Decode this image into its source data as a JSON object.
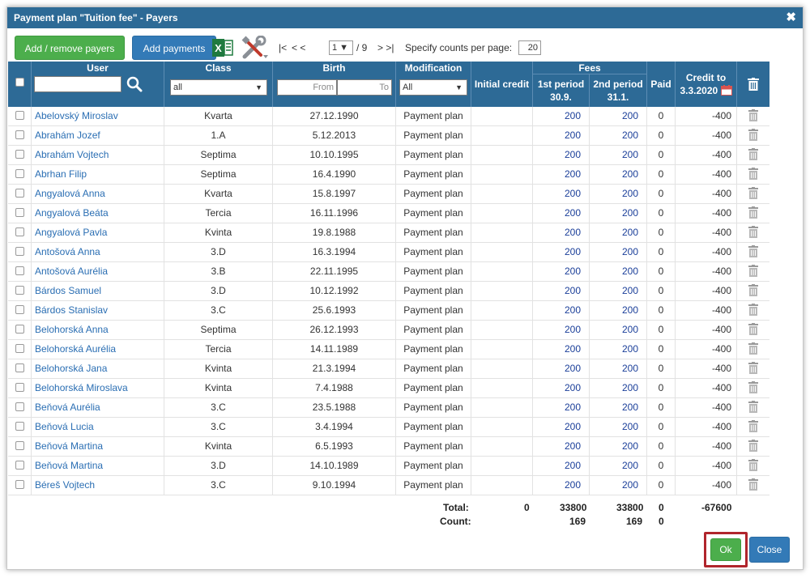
{
  "dialog": {
    "title": "Payment plan \"Tuition fee\" - Payers",
    "close_glyph": "✖"
  },
  "toolbar": {
    "add_remove_label": "Add / remove payers",
    "add_payments_label": "Add payments",
    "excel_icon": "excel-export-icon",
    "tools_icon": "tools-icon",
    "pager_first": "|<",
    "pager_prev": "< <",
    "page_value": "1 ▼",
    "page_total": "/ 9",
    "pager_next": "> >|",
    "counts_label": "Specify counts per page:",
    "counts_value": "20"
  },
  "columns": {
    "user": "User",
    "class": "Class",
    "birth": "Birth",
    "modification": "Modification",
    "initial_credit": "Initial credit",
    "fees": "Fees",
    "period1": "1st period",
    "period1_date": "30.9.",
    "period2": "2nd period",
    "period2_date": "31.1.",
    "paid": "Paid",
    "credit_to": "Credit to",
    "credit_date": "3.3.2020"
  },
  "filters": {
    "user_value": "",
    "class_value": "all",
    "birth_from_placeholder": "From",
    "birth_to_placeholder": "To",
    "modification_value": "All"
  },
  "rows": [
    {
      "user": "Abelovský Miroslav",
      "class": "Kvarta",
      "birth": "27.12.1990",
      "mod": "Payment plan",
      "init": "",
      "p1": "200",
      "p2": "200",
      "paid": "0",
      "credit": "-400"
    },
    {
      "user": "Abrahám Jozef",
      "class": "1.A",
      "birth": "5.12.2013",
      "mod": "Payment plan",
      "init": "",
      "p1": "200",
      "p2": "200",
      "paid": "0",
      "credit": "-400"
    },
    {
      "user": "Abrahám Vojtech",
      "class": "Septima",
      "birth": "10.10.1995",
      "mod": "Payment plan",
      "init": "",
      "p1": "200",
      "p2": "200",
      "paid": "0",
      "credit": "-400"
    },
    {
      "user": "Abrhan Filip",
      "class": "Septima",
      "birth": "16.4.1990",
      "mod": "Payment plan",
      "init": "",
      "p1": "200",
      "p2": "200",
      "paid": "0",
      "credit": "-400"
    },
    {
      "user": "Angyalová Anna",
      "class": "Kvarta",
      "birth": "15.8.1997",
      "mod": "Payment plan",
      "init": "",
      "p1": "200",
      "p2": "200",
      "paid": "0",
      "credit": "-400"
    },
    {
      "user": "Angyalová Beáta",
      "class": "Tercia",
      "birth": "16.11.1996",
      "mod": "Payment plan",
      "init": "",
      "p1": "200",
      "p2": "200",
      "paid": "0",
      "credit": "-400"
    },
    {
      "user": "Angyalová Pavla",
      "class": "Kvinta",
      "birth": "19.8.1988",
      "mod": "Payment plan",
      "init": "",
      "p1": "200",
      "p2": "200",
      "paid": "0",
      "credit": "-400"
    },
    {
      "user": "Antošová Anna",
      "class": "3.D",
      "birth": "16.3.1994",
      "mod": "Payment plan",
      "init": "",
      "p1": "200",
      "p2": "200",
      "paid": "0",
      "credit": "-400"
    },
    {
      "user": "Antošová Aurélia",
      "class": "3.B",
      "birth": "22.11.1995",
      "mod": "Payment plan",
      "init": "",
      "p1": "200",
      "p2": "200",
      "paid": "0",
      "credit": "-400"
    },
    {
      "user": "Bárdos Samuel",
      "class": "3.D",
      "birth": "10.12.1992",
      "mod": "Payment plan",
      "init": "",
      "p1": "200",
      "p2": "200",
      "paid": "0",
      "credit": "-400"
    },
    {
      "user": "Bárdos Stanislav",
      "class": "3.C",
      "birth": "25.6.1993",
      "mod": "Payment plan",
      "init": "",
      "p1": "200",
      "p2": "200",
      "paid": "0",
      "credit": "-400"
    },
    {
      "user": "Belohorská Anna",
      "class": "Septima",
      "birth": "26.12.1993",
      "mod": "Payment plan",
      "init": "",
      "p1": "200",
      "p2": "200",
      "paid": "0",
      "credit": "-400"
    },
    {
      "user": "Belohorská Aurélia",
      "class": "Tercia",
      "birth": "14.11.1989",
      "mod": "Payment plan",
      "init": "",
      "p1": "200",
      "p2": "200",
      "paid": "0",
      "credit": "-400"
    },
    {
      "user": "Belohorská Jana",
      "class": "Kvinta",
      "birth": "21.3.1994",
      "mod": "Payment plan",
      "init": "",
      "p1": "200",
      "p2": "200",
      "paid": "0",
      "credit": "-400"
    },
    {
      "user": "Belohorská Miroslava",
      "class": "Kvinta",
      "birth": "7.4.1988",
      "mod": "Payment plan",
      "init": "",
      "p1": "200",
      "p2": "200",
      "paid": "0",
      "credit": "-400"
    },
    {
      "user": "Beňová Aurélia",
      "class": "3.C",
      "birth": "23.5.1988",
      "mod": "Payment plan",
      "init": "",
      "p1": "200",
      "p2": "200",
      "paid": "0",
      "credit": "-400"
    },
    {
      "user": "Beňová Lucia",
      "class": "3.C",
      "birth": "3.4.1994",
      "mod": "Payment plan",
      "init": "",
      "p1": "200",
      "p2": "200",
      "paid": "0",
      "credit": "-400"
    },
    {
      "user": "Beňová Martina",
      "class": "Kvinta",
      "birth": "6.5.1993",
      "mod": "Payment plan",
      "init": "",
      "p1": "200",
      "p2": "200",
      "paid": "0",
      "credit": "-400"
    },
    {
      "user": "Beňová Martina",
      "class": "3.D",
      "birth": "14.10.1989",
      "mod": "Payment plan",
      "init": "",
      "p1": "200",
      "p2": "200",
      "paid": "0",
      "credit": "-400"
    },
    {
      "user": "Béreš Vojtech",
      "class": "3.C",
      "birth": "9.10.1994",
      "mod": "Payment plan",
      "init": "",
      "p1": "200",
      "p2": "200",
      "paid": "0",
      "credit": "-400"
    }
  ],
  "totals": {
    "total_label": "Total:",
    "count_label": "Count:",
    "init_total": "0",
    "p1_total": "33800",
    "p2_total": "33800",
    "paid_total": "0",
    "credit_total": "-67600",
    "p1_count": "169",
    "p2_count": "169",
    "paid_count": "0"
  },
  "footer": {
    "ok_label": "Ok",
    "close_label": "Close"
  },
  "colors": {
    "header_blue": "#2d6a96",
    "green": "#4cae4c",
    "blue_button": "#337ab7",
    "highlight_red": "#b0252c",
    "link": "#2a6eb3"
  }
}
